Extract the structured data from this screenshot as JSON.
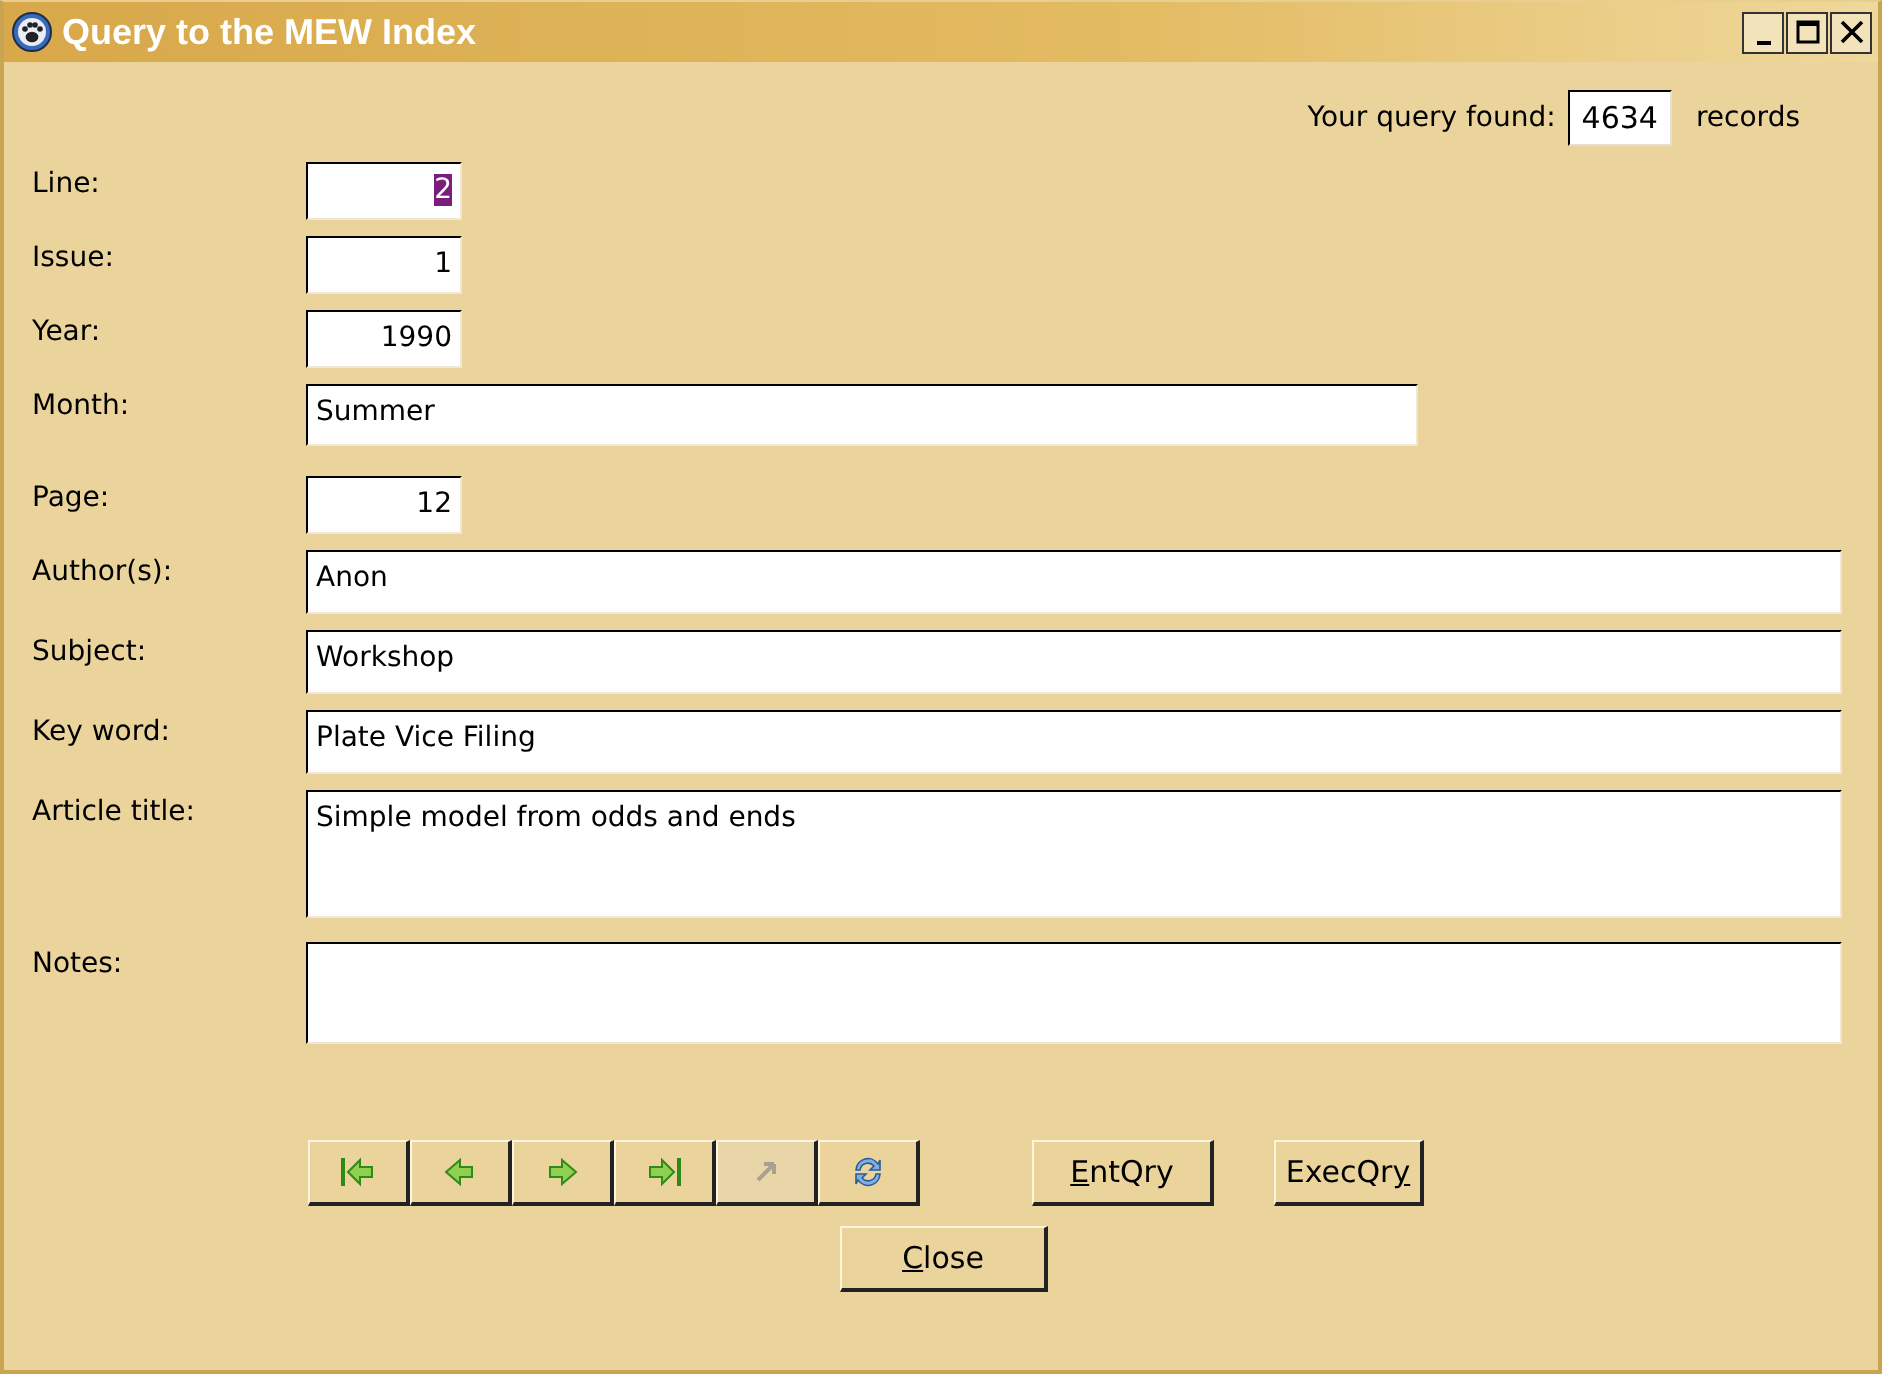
{
  "window": {
    "title": "Query to the MEW Index",
    "controls": [
      {
        "kind": "minimize"
      },
      {
        "kind": "maximize"
      },
      {
        "kind": "close"
      }
    ]
  },
  "query_count": {
    "label": "Your query found:",
    "value": "4634",
    "suffix": "records"
  },
  "fields": [
    {
      "label": "Line:",
      "value": "2",
      "kind": "number",
      "highlighted": true
    },
    {
      "label": "Issue:",
      "value": "1",
      "kind": "number",
      "highlighted": false
    },
    {
      "label": "Year:",
      "value": "1990",
      "kind": "number",
      "highlighted": false
    },
    {
      "label": "Month:",
      "value": "Summer",
      "kind": "medium",
      "highlighted": false
    },
    {
      "label": "Page:",
      "value": "12",
      "kind": "number",
      "highlighted": false
    },
    {
      "label": "Author(s):",
      "value": "Anon",
      "kind": "wide",
      "highlighted": false
    },
    {
      "label": "Subject:",
      "value": "Workshop",
      "kind": "wide",
      "highlighted": false
    },
    {
      "label": "Key word:",
      "value": "Plate Vice Filing",
      "kind": "wide",
      "highlighted": false
    },
    {
      "label": "Article title:",
      "value": "Simple model from odds and ends",
      "kind": "tall",
      "highlighted": false
    },
    {
      "label": "Notes:",
      "kind": "notes"
    }
  ],
  "navigator": [
    {
      "kind": "first",
      "disabled": false
    },
    {
      "kind": "prev",
      "disabled": false
    },
    {
      "kind": "next",
      "disabled": false
    },
    {
      "kind": "last",
      "disabled": false
    },
    {
      "kind": "undo",
      "disabled": true
    },
    {
      "kind": "refresh",
      "disabled": false
    }
  ],
  "buttons": [
    {
      "accel": "E",
      "after": "ntQry"
    },
    {
      "before": "ExecQr",
      "accel": "y"
    }
  ],
  "close_button": {
    "accel": "C",
    "after": "lose"
  }
}
